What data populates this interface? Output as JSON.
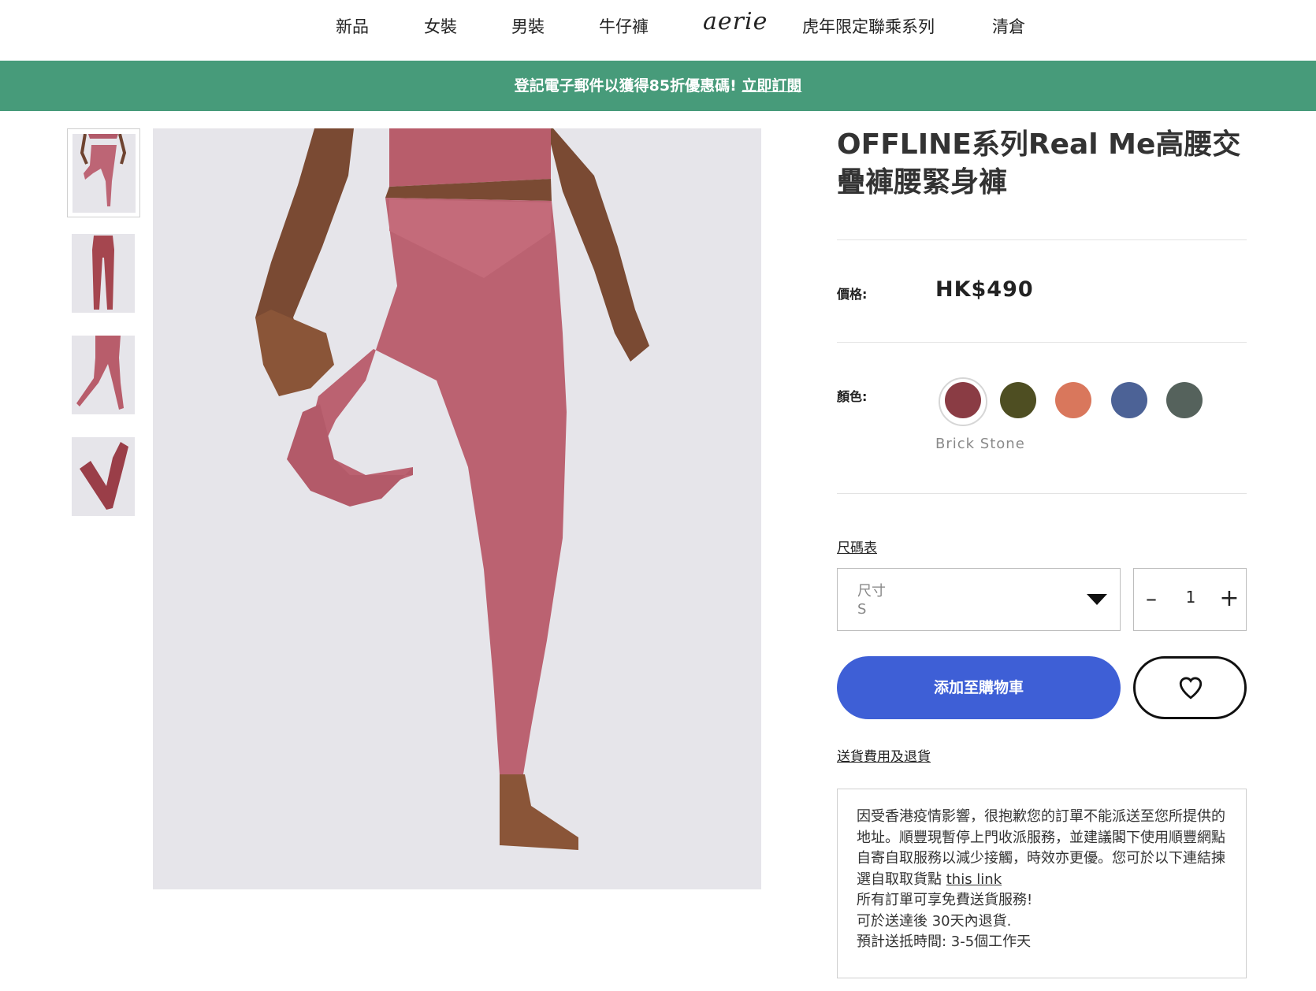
{
  "nav": {
    "items": [
      "新品",
      "女裝",
      "男裝",
      "牛仔褲"
    ],
    "logo": "aerie",
    "items_right": [
      "虎年限定聯乘系列",
      "清倉"
    ]
  },
  "promo": {
    "text": "登記電子郵件以獲得85折優惠碼! ",
    "link": "立即訂閱"
  },
  "product": {
    "title": "OFFLINE系列Real Me高腰交疊褲腰緊身褲",
    "price_label": "價格:",
    "price": "HK$490",
    "color_label": "顏色:",
    "colors": [
      "#8a3c44",
      "#4e4e22",
      "#d9775c",
      "#4c6296",
      "#55625c"
    ],
    "selected_color_name": "Brick Stone",
    "size_chart_link": "尺碼表",
    "size_select": {
      "caption": "尺寸",
      "value": "S"
    },
    "quantity": {
      "minus": "–",
      "value": "1",
      "plus": "+"
    },
    "add_to_cart": "添加至購物車",
    "shipping_link": "送貨費用及退貨"
  },
  "notice": {
    "body": "因受香港疫情影響，很抱歉您的訂單不能派送至您所提供的地址。順豐現暫停上門收派服務，並建議閣下使用順豐網點自寄自取服務以減少接觸，時效亦更優。您可於以下連結揀選自取取貨點 ",
    "link_text": "this link",
    "line2": "所有訂單可享免費送貨服務!",
    "line3": "可於送達後 30天內退貨.",
    "line4": "預計送抵時間: 3-5個工作天"
  }
}
